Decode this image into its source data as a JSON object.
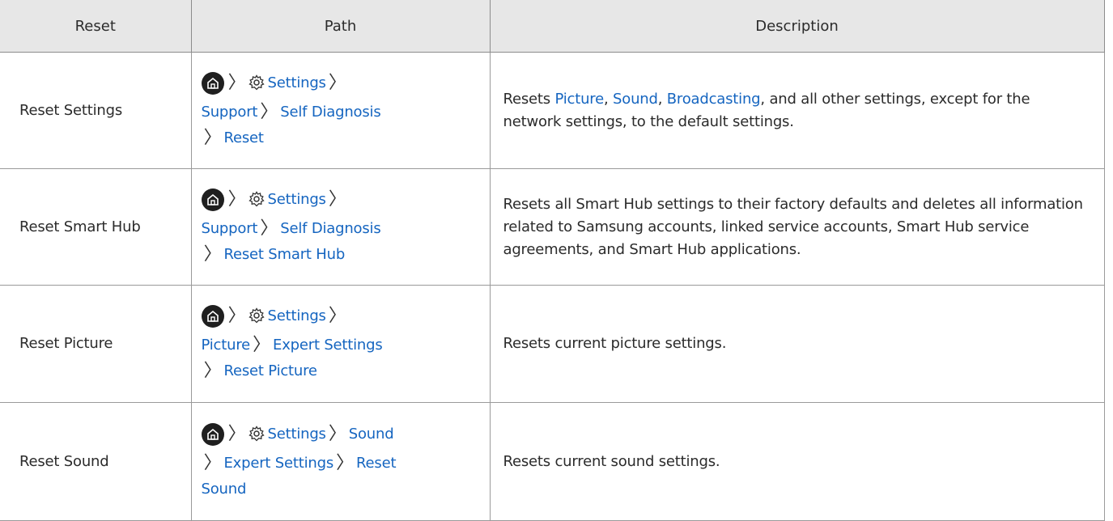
{
  "headers": {
    "reset": "Reset",
    "path": "Path",
    "description": "Description"
  },
  "chevron": "〉",
  "rows": [
    {
      "reset": "Reset Settings",
      "path": {
        "p1": "Settings",
        "p2": "Support",
        "p3": "Self Diagnosis",
        "p4": "Reset"
      },
      "desc": {
        "t1": "Resets ",
        "link1": "Picture",
        "t2": ", ",
        "link2": "Sound",
        "t3": ", ",
        "link3": "Broadcasting",
        "t4": ", and all other settings, except for the network settings, to the default settings."
      }
    },
    {
      "reset": "Reset Smart Hub",
      "path": {
        "p1": "Settings",
        "p2": "Support",
        "p3": "Self Diagnosis",
        "p4": "Reset Smart Hub"
      },
      "desc": "Resets all Smart Hub settings to their factory defaults and deletes all information related to Samsung accounts, linked service accounts, Smart Hub service agreements, and Smart Hub applications."
    },
    {
      "reset": "Reset Picture",
      "path": {
        "p1": "Settings",
        "p2": "Picture",
        "p3": "Expert Settings",
        "p4": "Reset Picture"
      },
      "desc": "Resets current picture settings."
    },
    {
      "reset": "Reset Sound",
      "path": {
        "p1": "Settings",
        "p2": "Sound",
        "p3": "Expert Settings",
        "p4": "Reset",
        "p5": "Sound"
      },
      "desc": "Resets current sound settings."
    }
  ],
  "icons": {
    "home": "home-icon",
    "settings": "gear-icon"
  },
  "colors": {
    "link": "#1565c0",
    "header_bg": "#e7e7e7",
    "border": "#9a9a9a"
  }
}
